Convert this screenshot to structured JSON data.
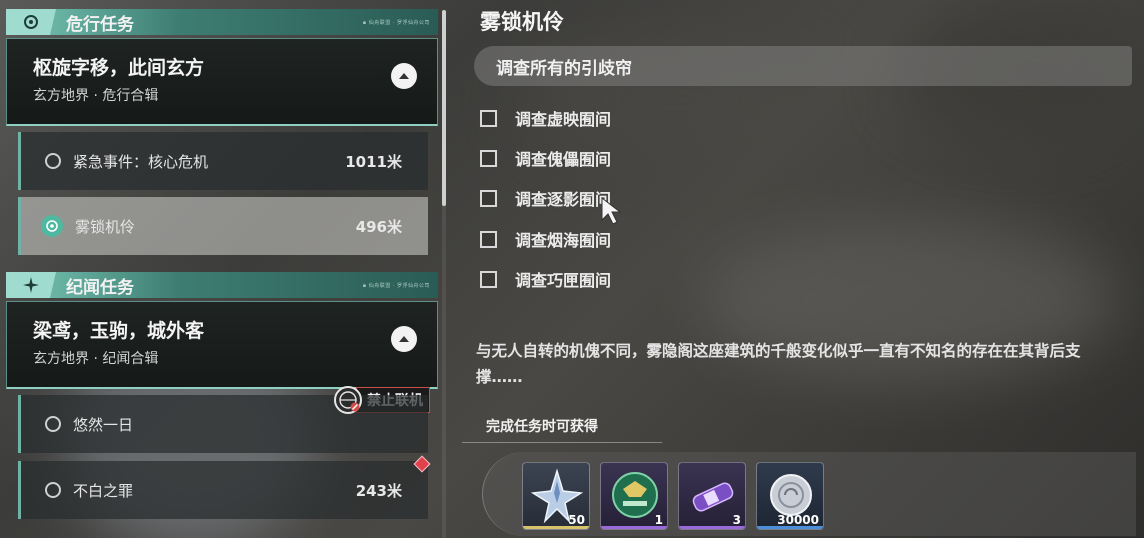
{
  "categories": [
    {
      "title": "危行任务",
      "deco": "▪ 仙舟联盟 · 罗浮仙舟公司",
      "quest": {
        "title": "枢旋字移，此间玄方",
        "sub": "玄方地界 · 危行合辑"
      },
      "items": [
        {
          "name": "紧急事件：核心危机",
          "dist": "1011米"
        },
        {
          "name": "雾锁机伶",
          "dist": "496米"
        }
      ]
    },
    {
      "title": "纪闻任务",
      "deco": "▪ 仙舟联盟 · 罗浮仙舟公司",
      "quest": {
        "title": "梁鸢，玉驹，城外客",
        "sub": "玄方地界 · 纪闻合辑"
      },
      "items": [
        {
          "name": "悠然一日",
          "dist": ""
        },
        {
          "name": "不白之罪",
          "dist": "243米"
        }
      ]
    }
  ],
  "no_coop_label": "禁止联机",
  "detail": {
    "title": "雾锁机伶",
    "objective": "调查所有的引歧帘",
    "checklist": [
      "调查虚映囿间",
      "调查傀儡囿间",
      "调查逐影囿间",
      "调查烟海囿间",
      "调查巧匣囿间"
    ],
    "description": "与无人自转的机傀不同，雾隐阁这座建筑的千般变化似乎一直有不知名的存在在其背后支撑……",
    "reward_label": "完成任务时可获得",
    "rewards": [
      {
        "icon": "crystal-star-icon",
        "qty": "50",
        "color": "#d8c26a"
      },
      {
        "icon": "green-emblem-icon",
        "qty": "1",
        "color": "#9a6bd8"
      },
      {
        "icon": "purple-capsule-icon",
        "qty": "3",
        "color": "#9a6bd8"
      },
      {
        "icon": "silver-coin-icon",
        "qty": "30000",
        "color": "#4a8fd8"
      }
    ]
  }
}
